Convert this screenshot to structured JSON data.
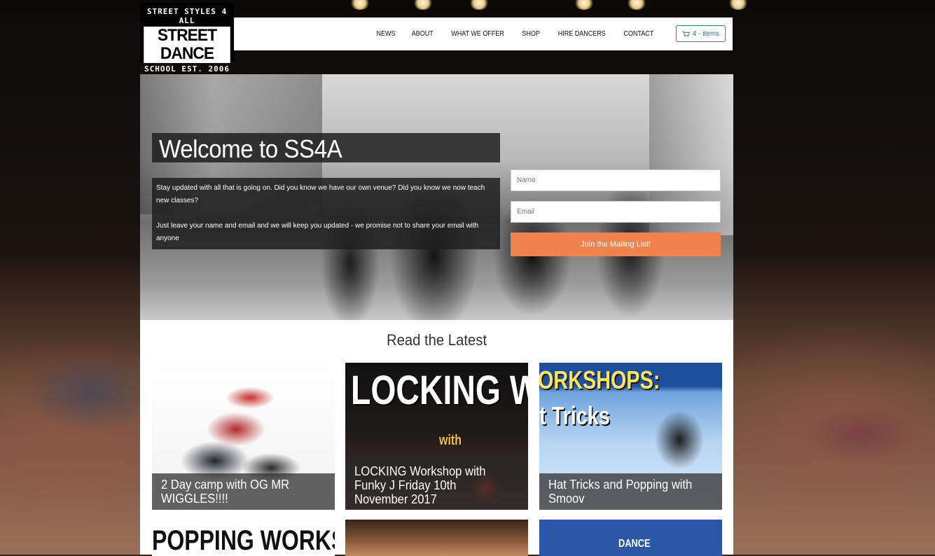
{
  "logo": {
    "line1": "STREET STYLES 4 ALL",
    "line2": "STREET DANCE",
    "line3": "SCHOOL EST. 2006"
  },
  "nav": {
    "items": [
      {
        "label": "NEWS"
      },
      {
        "label": "ABOUT"
      },
      {
        "label": "WHAT WE OFFER"
      },
      {
        "label": "SHOP"
      },
      {
        "label": "HIRE DANCERS"
      },
      {
        "label": "CONTACT"
      }
    ],
    "cart_label": "4 - items",
    "cart_icon": "cart-icon"
  },
  "hero": {
    "title": "Welcome to SS4A",
    "paragraph1": "Stay updated with all that is going on.  Did you know we have our own venue?  Did you know we now teach new classes?",
    "paragraph2": "Just leave your name and email and we will keep you updated - we promise not to share your email with anyone",
    "form": {
      "name_placeholder": "Name",
      "email_placeholder": "Email",
      "submit_label": "Join the Mailing List!"
    }
  },
  "latest": {
    "title": "Read the Latest",
    "posts": [
      {
        "caption": "2 Day camp with OG MR WIGGLES!!!!",
        "image_text": ""
      },
      {
        "caption": "LOCKING Workshop with Funky J Friday 10th November 2017",
        "image_text": "LOCKING WO",
        "image_subtext": "with"
      },
      {
        "caption": "Hat Tricks and Popping with Smoov",
        "image_text": "ORKSHOPS:",
        "image_subtext": "t Tricks"
      }
    ],
    "row2": [
      {
        "image_text": "POPPING WORKSHOP"
      },
      {
        "image_text": ""
      },
      {
        "image_text": "DANCE"
      }
    ]
  },
  "colors": {
    "accent": "#f0834d",
    "cart_border": "#2f7fb5"
  }
}
